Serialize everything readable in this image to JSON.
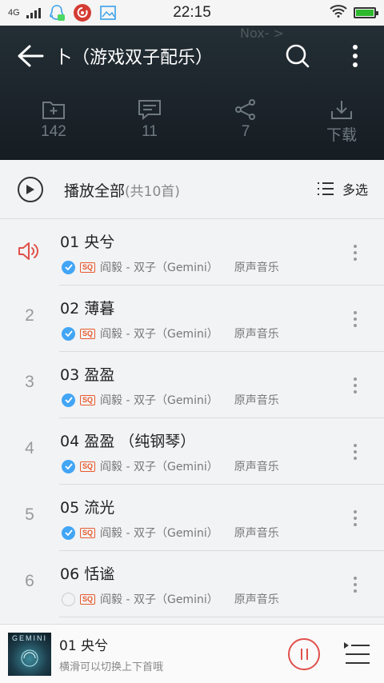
{
  "status_bar": {
    "network": "4G",
    "time": "22:15"
  },
  "header": {
    "bg_text": "Nox- >",
    "title": "卜（游戏双子配乐）",
    "stats": [
      {
        "icon": "folder-plus-icon",
        "label": "142"
      },
      {
        "icon": "comment-icon",
        "label": "11"
      },
      {
        "icon": "share-icon",
        "label": "7"
      },
      {
        "icon": "download-icon",
        "label": "下载"
      }
    ]
  },
  "play_all": {
    "label": "播放全部",
    "count": "(共10首)",
    "multi_select": "多选"
  },
  "songs": [
    {
      "index": "",
      "name": "01 央兮",
      "artist": "阎毅 - 双子（Gemini）",
      "album": "原声音乐",
      "checked": true,
      "playing": true
    },
    {
      "index": "2",
      "name": "02 薄暮",
      "artist": "阎毅 - 双子（Gemini）",
      "album": "原声音乐",
      "checked": true,
      "playing": false
    },
    {
      "index": "3",
      "name": "03 盈盈",
      "artist": "阎毅 - 双子（Gemini）",
      "album": "原声音乐",
      "checked": true,
      "playing": false
    },
    {
      "index": "4",
      "name": "04 盈盈 （纯钢琴）",
      "artist": "阎毅 - 双子（Gemini）",
      "album": "原声音乐",
      "checked": true,
      "playing": false
    },
    {
      "index": "5",
      "name": "05 流光",
      "artist": "阎毅 - 双子（Gemini）",
      "album": "原声音乐",
      "checked": true,
      "playing": false
    },
    {
      "index": "6",
      "name": "06 恬谧",
      "artist": "阎毅 - 双子（Gemini）",
      "album": "原声音乐",
      "checked": false,
      "playing": false
    }
  ],
  "sq_badge": "SQ",
  "player": {
    "cover_text": "GEMINI",
    "title": "01 央兮",
    "subtitle": "横滑可以切换上下首哦"
  },
  "colors": {
    "accent_red": "#e0504a",
    "check_blue": "#42a5f5",
    "sq_orange": "#e85a2d",
    "header_dark": "#1b2329"
  }
}
